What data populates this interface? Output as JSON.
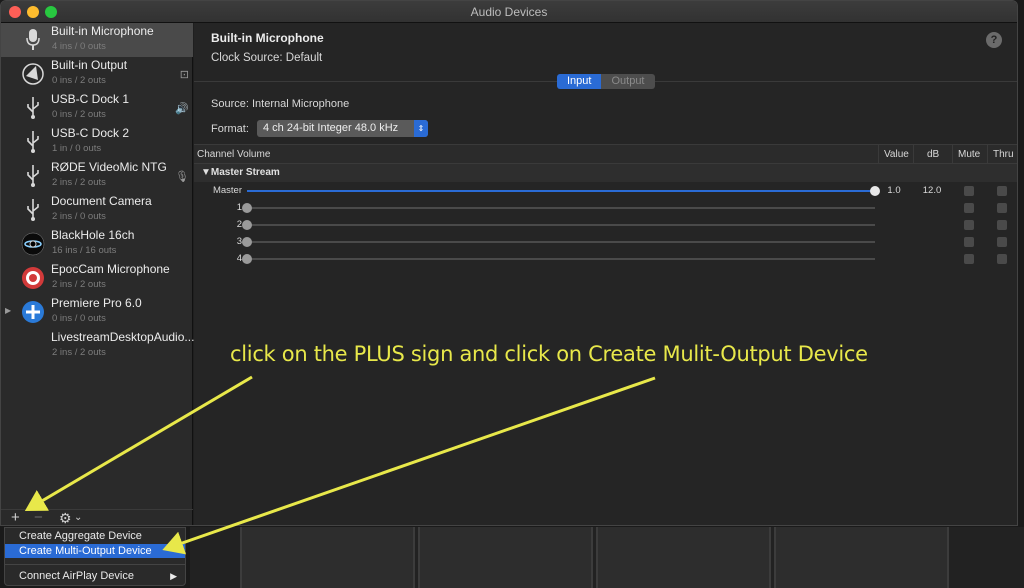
{
  "window": {
    "title": "Audio Devices"
  },
  "devices": [
    {
      "name": "Built-in Microphone",
      "sub": "4 ins / 0 outs",
      "icon": "microphone-icon",
      "badge": "",
      "selected": true
    },
    {
      "name": "Built-in Output",
      "sub": "0 ins / 2 outs",
      "icon": "speaker-icon",
      "badge": "⊡"
    },
    {
      "name": "USB-C Dock 1",
      "sub": "0 ins / 2 outs",
      "icon": "usb-icon",
      "badge": "🔊"
    },
    {
      "name": "USB-C Dock 2",
      "sub": "1 in / 0 outs",
      "icon": "usb-icon",
      "badge": ""
    },
    {
      "name": "RØDE VideoMic NTG",
      "sub": "2 ins / 2 outs",
      "icon": "usb-icon",
      "badge": "🎙"
    },
    {
      "name": "Document Camera",
      "sub": "2 ins / 0 outs",
      "icon": "usb-icon",
      "badge": ""
    },
    {
      "name": "BlackHole 16ch",
      "sub": "16 ins / 16 outs",
      "icon": "blackhole-icon",
      "badge": ""
    },
    {
      "name": "EpocCam Microphone",
      "sub": "2 ins / 2 outs",
      "icon": "epoccam-icon",
      "badge": ""
    },
    {
      "name": "Premiere Pro 6.0",
      "sub": "0 ins / 0 outs",
      "icon": "premiere-icon",
      "badge": ""
    },
    {
      "name": "LivestreamDesktopAudio...",
      "sub": "2 ins / 2 outs",
      "icon": "",
      "badge": ""
    }
  ],
  "sidebar_bottom": {
    "add": "+",
    "remove": "−",
    "gear": "⚙",
    "gear_caret": "⌄"
  },
  "detail": {
    "name": "Built-in Microphone",
    "clock_source": "Clock Source:  Default",
    "help": "?",
    "tabs": {
      "input": "Input",
      "output": "Output"
    },
    "source": "Source:  Internal Microphone",
    "format_label": "Format:",
    "format_value": "4 ch 24-bit Integer 48.0 kHz",
    "table_headers": {
      "channel_volume": "Channel Volume",
      "value": "Value",
      "db": "dB",
      "mute": "Mute",
      "thru": "Thru"
    },
    "group": "▼Master Stream",
    "channels": [
      {
        "label": "Master",
        "value": "1.0",
        "db": "12.0",
        "level": 1.0
      },
      {
        "label": "1",
        "value": "",
        "db": "",
        "level": 0
      },
      {
        "label": "2",
        "value": "",
        "db": "",
        "level": 0
      },
      {
        "label": "3",
        "value": "",
        "db": "",
        "level": 0
      },
      {
        "label": "4",
        "value": "",
        "db": "",
        "level": 0
      }
    ]
  },
  "menu": {
    "items": [
      "Create Aggregate Device",
      "Create Multi-Output Device",
      "Connect AirPlay Device"
    ],
    "submenu_arrow": "▶"
  },
  "annotation": "click on the PLUS sign and click on Create Mulit-Output Device",
  "colors": {
    "accent": "#2a6bd5",
    "annotation": "#e8e84a"
  }
}
